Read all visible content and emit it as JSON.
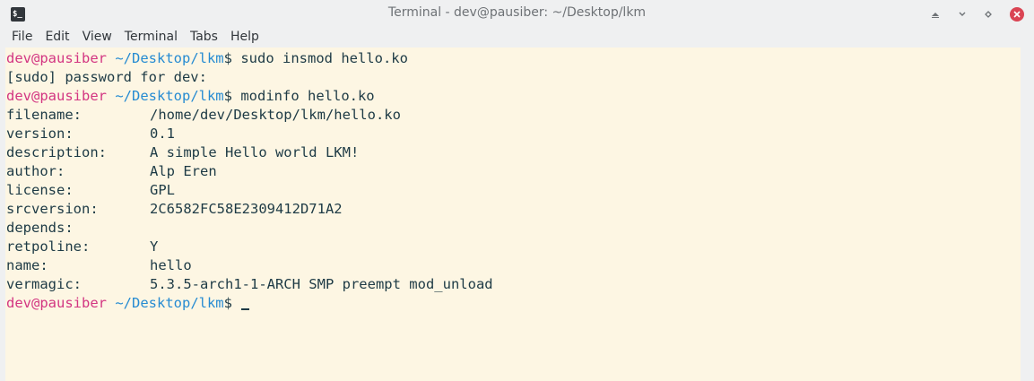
{
  "window": {
    "title": "Terminal - dev@pausiber: ~/Desktop/lkm",
    "app_icon_text": "$_"
  },
  "menu": [
    "File",
    "Edit",
    "View",
    "Terminal",
    "Tabs",
    "Help"
  ],
  "prompt": {
    "user_host": "dev@pausiber",
    "path": "~/Desktop/lkm",
    "symbol": "$"
  },
  "commands": {
    "insmod": " sudo insmod hello.ko",
    "sudo_prompt": "[sudo] password for dev:",
    "modinfo": " modinfo hello.ko"
  },
  "modinfo": [
    {
      "key": "filename:",
      "value": "/home/dev/Desktop/lkm/hello.ko"
    },
    {
      "key": "version:",
      "value": "0.1"
    },
    {
      "key": "description:",
      "value": "A simple Hello world LKM!"
    },
    {
      "key": "author:",
      "value": "Alp Eren"
    },
    {
      "key": "license:",
      "value": "GPL"
    },
    {
      "key": "srcversion:",
      "value": "2C6582FC58E2309412D71A2"
    },
    {
      "key": "depends:",
      "value": ""
    },
    {
      "key": "retpoline:",
      "value": "Y"
    },
    {
      "key": "name:",
      "value": "hello"
    },
    {
      "key": "vermagic:",
      "value": "5.3.5-arch1-1-ARCH SMP preempt mod_unload"
    }
  ],
  "colors": {
    "background": "#fdf6e3",
    "foreground": "#1d3a45",
    "user": "#d33682",
    "path": "#268bd2",
    "close": "#da4453"
  }
}
